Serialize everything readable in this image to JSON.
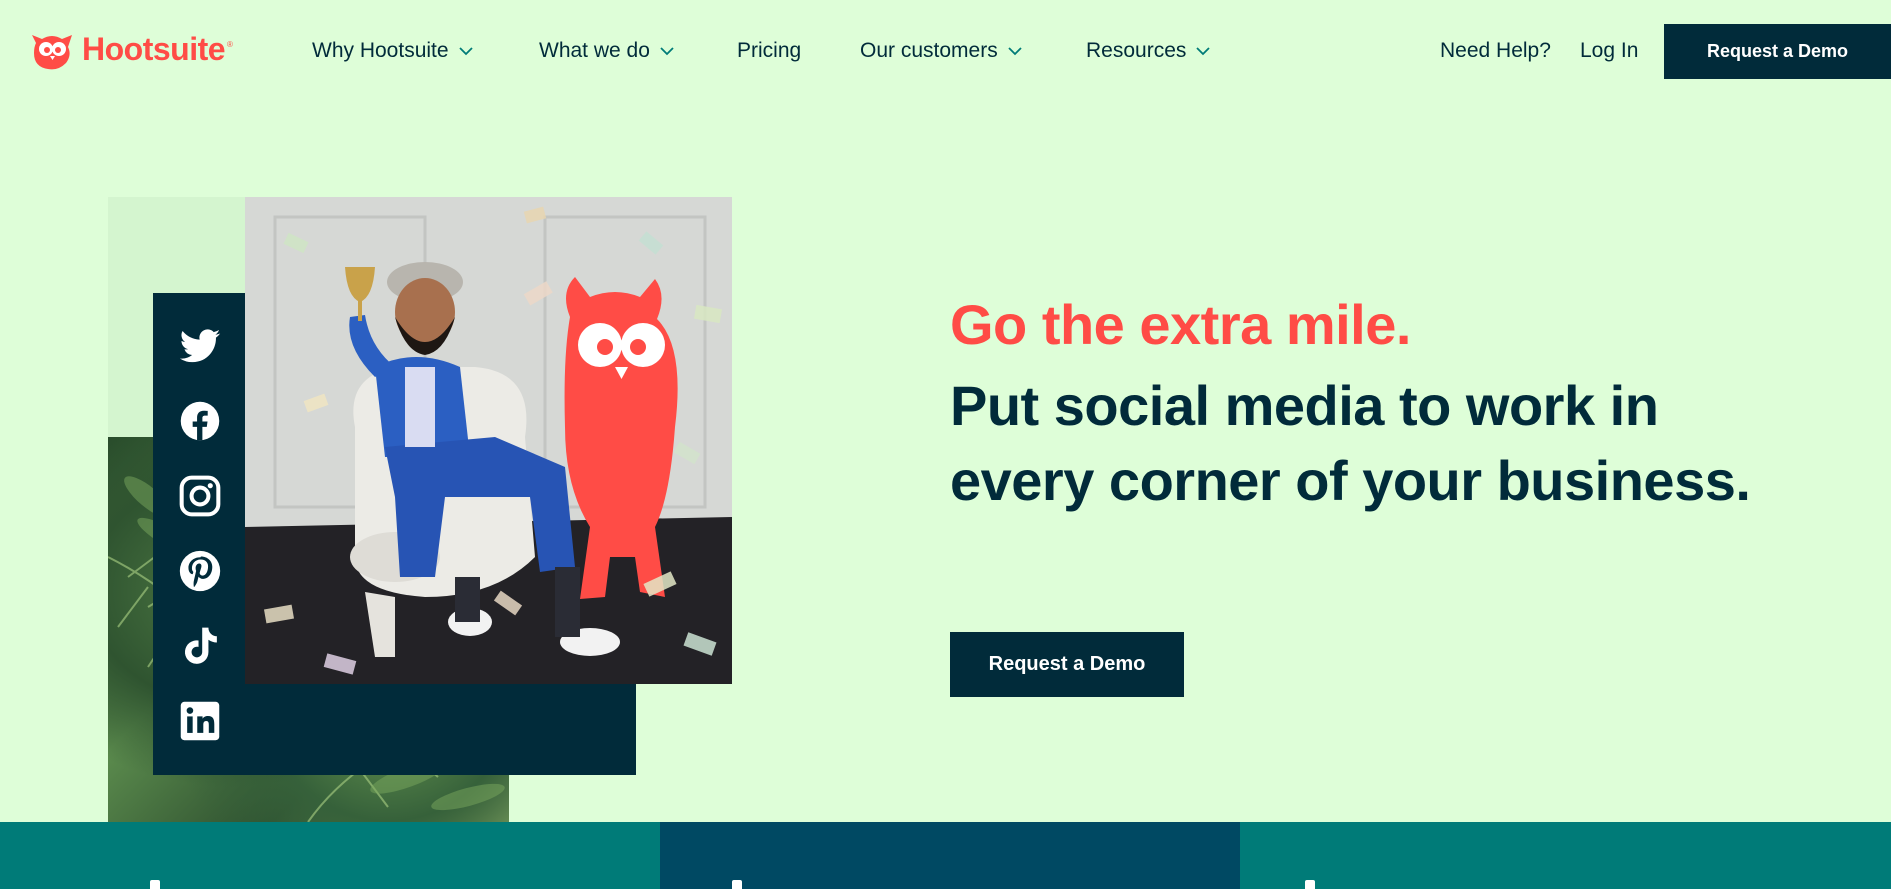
{
  "brand": {
    "name": "Hootsuite",
    "trademark": "®",
    "accent_color": "#ff4c46",
    "dark_color": "#012b3a",
    "background_color": "#defed8"
  },
  "nav": {
    "items": [
      {
        "label": "Why Hootsuite",
        "has_dropdown": true
      },
      {
        "label": "What we do",
        "has_dropdown": true
      },
      {
        "label": "Pricing",
        "has_dropdown": false
      },
      {
        "label": "Our customers",
        "has_dropdown": true
      },
      {
        "label": "Resources",
        "has_dropdown": true
      }
    ],
    "help_label": "Need Help?",
    "login_label": "Log In",
    "demo_label": "Request a Demo"
  },
  "social": {
    "icons": [
      "twitter-icon",
      "facebook-icon",
      "instagram-icon",
      "pinterest-icon",
      "tiktok-icon",
      "linkedin-icon"
    ]
  },
  "hero": {
    "accent": "Go the extra mile.",
    "title": "Put social media to work in every corner of your business.",
    "cta_label": "Request a Demo"
  },
  "band": {
    "colors": [
      "#007b78",
      "#004963",
      "#007b78"
    ]
  }
}
